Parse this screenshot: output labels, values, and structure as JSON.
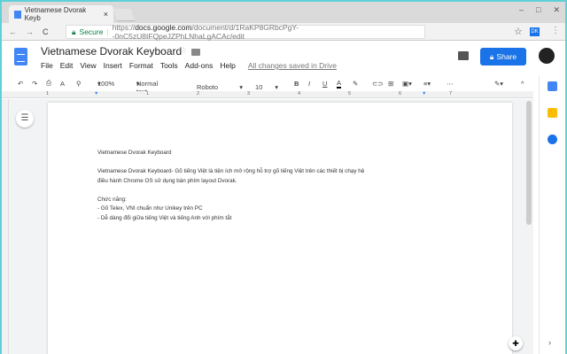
{
  "browser": {
    "tab_title": "Vietnamese Dvorak Keyb",
    "secure_label": "Secure",
    "url_prefix": "https://",
    "url_domain": "docs.google.com",
    "url_path": "/document/d/1RaKP8GRbcPgY--0nC5zU8IFQpeJZPhLNhaLgACAc/edit",
    "extension_label": "DK"
  },
  "doc": {
    "title": "Vietnamese Dvorak Keyboard",
    "menus": [
      "File",
      "Edit",
      "View",
      "Insert",
      "Format",
      "Tools",
      "Add-ons",
      "Help"
    ],
    "saved_status": "All changes saved in Drive",
    "share_label": "Share"
  },
  "toolbar": {
    "zoom": "100%",
    "style": "Normal text",
    "font": "Roboto",
    "size": "10"
  },
  "ruler": [
    "1",
    "1",
    "2",
    "3",
    "4",
    "5",
    "6",
    "7"
  ],
  "content": {
    "heading": "Vietnamese Dvorak Keyboard",
    "para1": "Vietnamese Dvorak Keyboard- Gõ tiếng Việt là tiện ích mở rộng hỗ trợ gõ tiếng Việt trên các thiết bị chạy hệ",
    "para2": "điều hành Chrome OS sử dụng bàn phím layout Dvorak.",
    "features_label": "Chức năng:",
    "feature1": "- Gõ Telex, VNI chuẩn như Unikey trên PC",
    "feature2": "- Dễ dàng đổi giữa tiếng Việt và tiếng Anh với phím tắt"
  },
  "colors": {
    "accent": "#1a73e8",
    "doc_blue": "#4285f4"
  }
}
